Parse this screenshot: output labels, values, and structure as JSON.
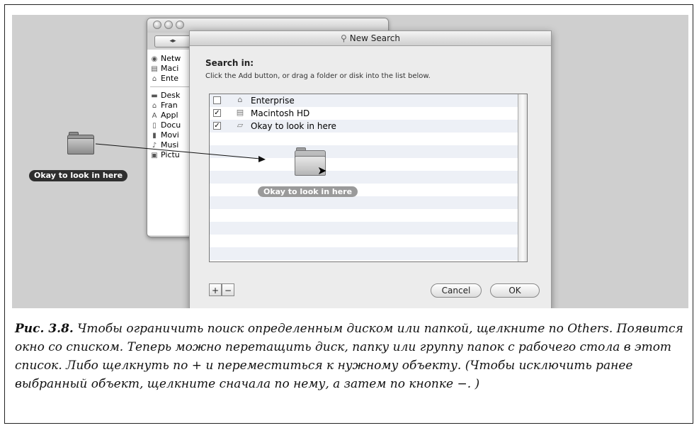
{
  "finder": {
    "nav_buttons": "◂▸",
    "sidebar_items": [
      {
        "label": "Netw",
        "icon": "network-icon"
      },
      {
        "label": "Maci",
        "icon": "hard-disk-icon"
      },
      {
        "label": "Ente",
        "icon": "enterprise-icon"
      },
      {
        "label": "Desk",
        "icon": "desktop-icon"
      },
      {
        "label": "Fran",
        "icon": "home-icon"
      },
      {
        "label": "Appl",
        "icon": "applications-icon"
      },
      {
        "label": "Docu",
        "icon": "documents-icon"
      },
      {
        "label": "Movi",
        "icon": "movies-icon"
      },
      {
        "label": "Musi",
        "icon": "music-icon"
      },
      {
        "label": "Pictu",
        "icon": "pictures-icon"
      }
    ]
  },
  "desktop": {
    "folder_label": "Okay to look in here"
  },
  "sheet": {
    "window_title": "New Search",
    "search_in_label": "Search in:",
    "instructions": "Click the Add button, or drag a folder or disk into the list below.",
    "rows": [
      {
        "label": "Enterprise",
        "checked": false,
        "icon": "enterprise-icon"
      },
      {
        "label": "Macintosh HD",
        "checked": true,
        "icon": "hard-disk-icon"
      },
      {
        "label": "Okay to look in here",
        "checked": true,
        "icon": "folder-icon"
      }
    ],
    "drag_label": "Okay to look in here",
    "add_label": "+",
    "remove_label": "−",
    "cancel_label": "Cancel",
    "ok_label": "OK"
  },
  "caption": {
    "figure": "Рис. 3.8.",
    "text": " Чтобы ограничить поиск определенным диском или папкой, щелкните по Others. Появится окно со списком. Теперь можно перетащить диск, папку или группу папок с рабочего стола в этот список. Либо щелкнуть по + и переместиться к нужному объекту. (Чтобы исключить ранее выбранный объект, щелкните сначала по нему, а затем по кнопке −. )"
  }
}
